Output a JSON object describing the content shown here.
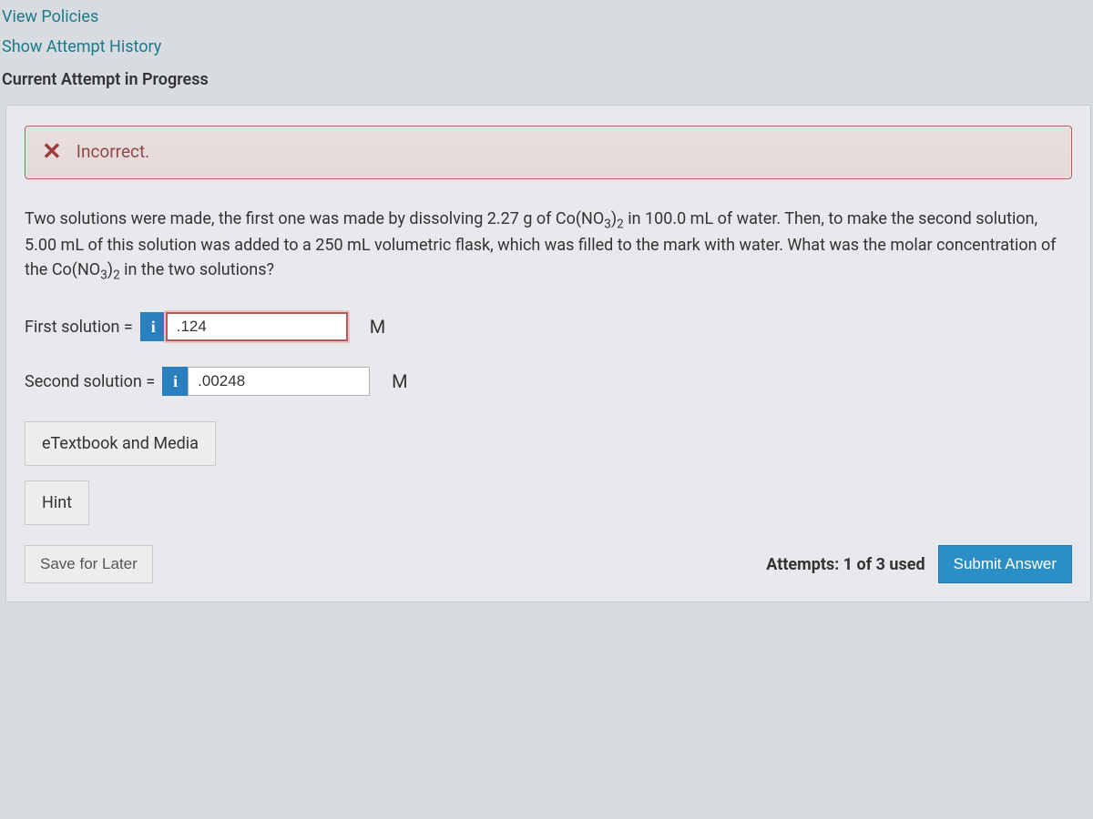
{
  "links": {
    "view_policies": "View Policies",
    "show_history": "Show Attempt History"
  },
  "current_attempt_label": "Current Attempt in Progress",
  "feedback": {
    "icon_glyph": "✕",
    "text": "Incorrect."
  },
  "question": {
    "pre": "Two solutions were made, the first one was made by dissolving 2.27 g of Co(NO",
    "sub1": "3",
    "mid1": ")",
    "sub2": "2",
    "mid2": " in 100.0 mL of water. Then, to make the second solution, 5.00 mL of this solution was added to a 250 mL volumetric flask, which was filled to the mark with water. What was the molar concentration of the Co(NO",
    "sub3": "3",
    "mid3": ")",
    "sub4": "2",
    "post": " in the two solutions?"
  },
  "answers": {
    "first": {
      "label": "First solution =",
      "info_glyph": "i",
      "value": ".124",
      "unit": "M"
    },
    "second": {
      "label": "Second solution =",
      "info_glyph": "i",
      "value": ".00248",
      "unit": "M"
    }
  },
  "resources": {
    "etextbook": "eTextbook and Media",
    "hint": "Hint"
  },
  "footer": {
    "save": "Save for Later",
    "attempts": "Attempts: 1 of 3 used",
    "submit": "Submit Answer"
  }
}
